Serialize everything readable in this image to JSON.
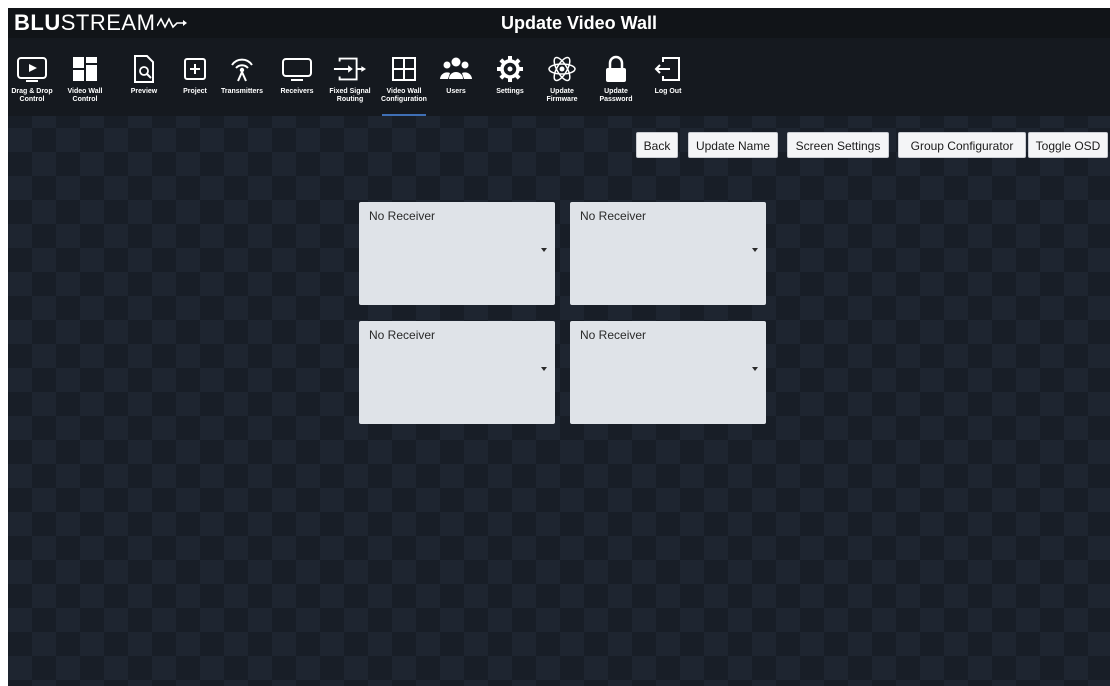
{
  "brand": {
    "bold": "BLU",
    "light": "STREAM"
  },
  "page_title": "Update Video Wall",
  "nav": [
    {
      "label": "Drag & Drop\nControl",
      "icon": "play-icon"
    },
    {
      "label": "Video Wall\nControl",
      "icon": "video-wall-icon"
    },
    {
      "label": "Preview",
      "icon": "preview-document-icon"
    },
    {
      "label": "Project",
      "icon": "plus-box-icon"
    },
    {
      "label": "Transmitters",
      "icon": "antenna-icon"
    },
    {
      "label": "Receivers",
      "icon": "monitor-icon"
    },
    {
      "label": "Fixed Signal\nRouting",
      "icon": "routing-icon"
    },
    {
      "label": "Video Wall\nConfiguration",
      "icon": "grid-icon",
      "active": true
    },
    {
      "label": "Users",
      "icon": "users-icon"
    },
    {
      "label": "Settings",
      "icon": "gear-icon"
    },
    {
      "label": "Update\nFirmware",
      "icon": "atom-icon"
    },
    {
      "label": "Update\nPassword",
      "icon": "lock-icon"
    },
    {
      "label": "Log Out",
      "icon": "logout-icon"
    }
  ],
  "actions": {
    "back": "Back",
    "update_name": "Update Name",
    "screen_settings": "Screen Settings",
    "group_configurator": "Group Configurator",
    "toggle_osd": "Toggle OSD"
  },
  "wall": {
    "tiles": [
      {
        "value": "No Receiver"
      },
      {
        "value": "No Receiver"
      },
      {
        "value": "No Receiver"
      },
      {
        "value": "No Receiver"
      }
    ]
  },
  "colors": {
    "background": "#1b212b",
    "topbar": "#111418",
    "active_underline": "#3f6fb5",
    "tile": "#dfe3e8"
  }
}
